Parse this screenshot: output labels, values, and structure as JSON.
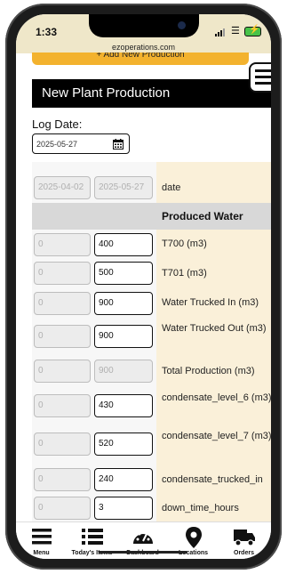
{
  "status": {
    "time": "1:33",
    "url": "ezoperations.com"
  },
  "top_button": {
    "label": "+ Add New Production"
  },
  "header": {
    "title": "New Plant Production"
  },
  "log_date": {
    "label": "Log Date:",
    "value": "2025-05-27"
  },
  "rows": [
    {
      "prev": "2025-04-02",
      "curr": "2025-05-27",
      "label": "date"
    },
    {
      "prev": "0",
      "curr": "400",
      "label": "T700 (m3)"
    },
    {
      "prev": "0",
      "curr": "500",
      "label": "T701 (m3)"
    },
    {
      "prev": "0",
      "curr": "900",
      "label": "Water Trucked In (m3)"
    },
    {
      "prev": "0",
      "curr": "900",
      "label": "Water Trucked Out (m3)"
    },
    {
      "prev": "0",
      "curr": "900",
      "label": "Total Production (m3)"
    },
    {
      "prev": "0",
      "curr": "430",
      "label": "condensate_level_6 (m3)"
    },
    {
      "prev": "0",
      "curr": "520",
      "label": "condensate_level_7 (m3)"
    },
    {
      "prev": "0",
      "curr": "240",
      "label": "condensate_trucked_in"
    },
    {
      "prev": "0",
      "curr": "3",
      "label": "down_time_hours"
    }
  ],
  "section_header": "Produced Water",
  "tabs": [
    {
      "label": "Menu",
      "icon": "menu-icon"
    },
    {
      "label": "Today's Items",
      "icon": "list-icon"
    },
    {
      "label": "Dashboard",
      "icon": "gauge-icon"
    },
    {
      "label": "Locations",
      "icon": "location-pin-icon"
    },
    {
      "label": "Orders",
      "icon": "truck-icon"
    }
  ],
  "colors": {
    "accent": "#f3b22e",
    "label_bg": "#faf0d9",
    "header_bg": "#000000"
  }
}
